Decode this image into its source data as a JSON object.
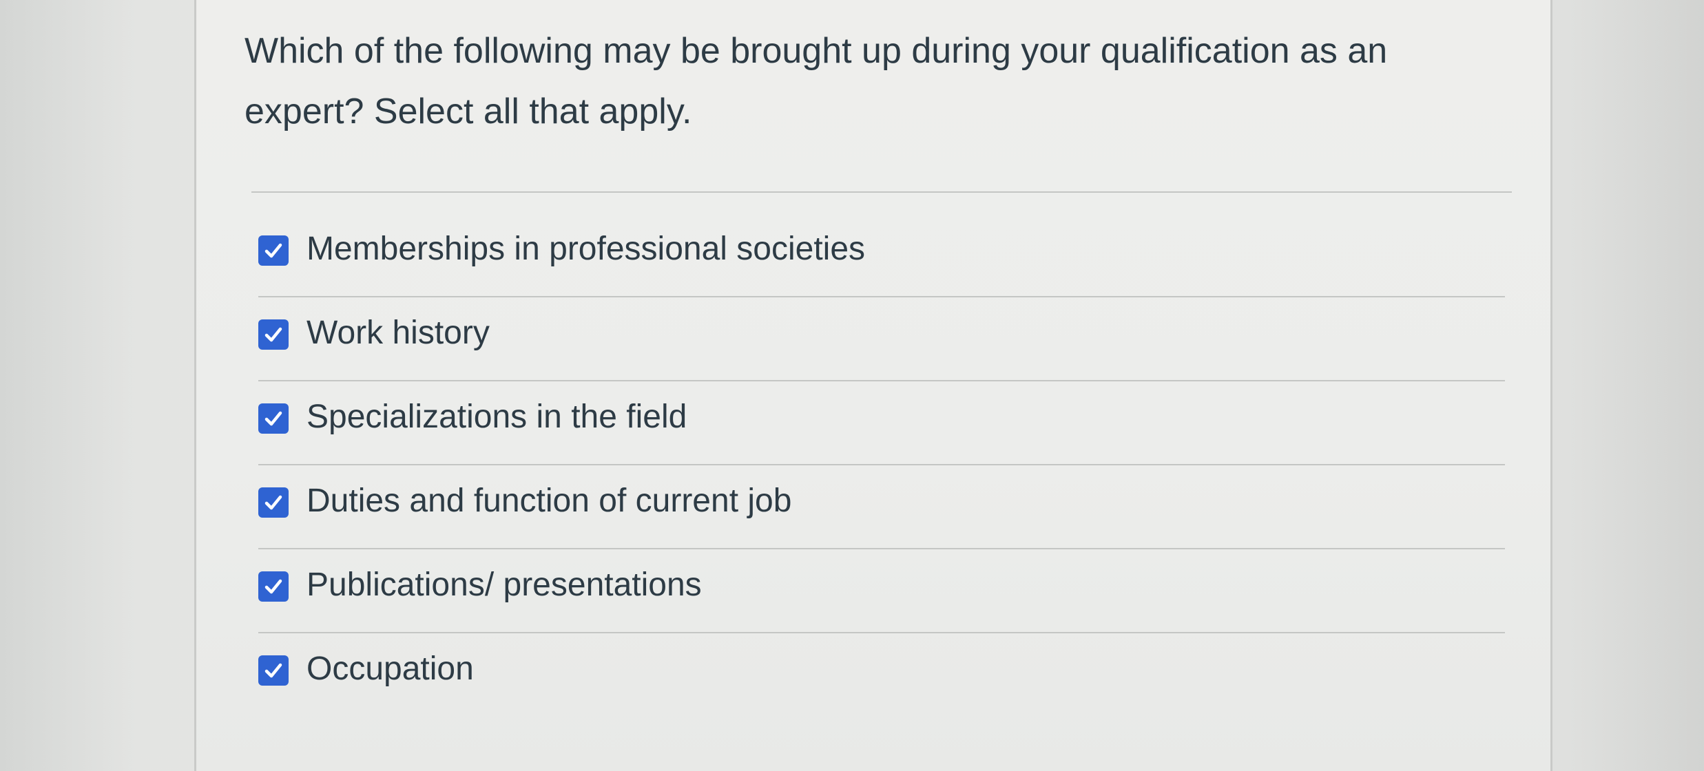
{
  "question": {
    "text": "Which of the following may be brought up during your qualification as an expert? Select all that apply."
  },
  "answers": [
    {
      "label": "Memberships in professional societies",
      "checked": true
    },
    {
      "label": "Work history",
      "checked": true
    },
    {
      "label": "Specializations in the field",
      "checked": true
    },
    {
      "label": "Duties and function of current job",
      "checked": true
    },
    {
      "label": "Publications/ presentations",
      "checked": true
    },
    {
      "label": "Occupation",
      "checked": true
    }
  ],
  "icons": {
    "checkbox": "checkmark-icon"
  },
  "colors": {
    "checkbox_fill": "#2f63d2",
    "text": "#2d3b45",
    "card_background": "#eeeeec"
  }
}
